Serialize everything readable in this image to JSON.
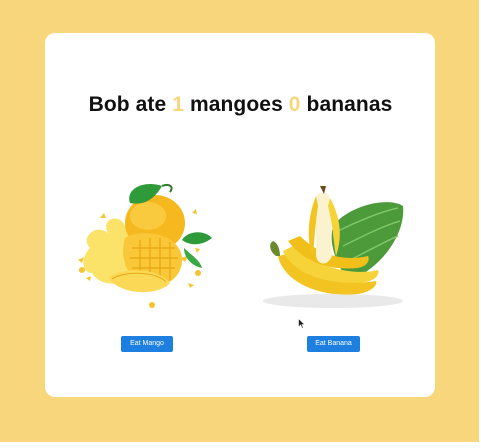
{
  "headline": {
    "prefix": "Bob ate",
    "mangoes_count": "1",
    "mangoes_label": "mangoes",
    "bananas_count": "0",
    "bananas_label": "bananas"
  },
  "buttons": {
    "eat_mango": "Eat Mango",
    "eat_banana": "Eat Banana"
  },
  "colors": {
    "background": "#f8d67c",
    "card": "#ffffff",
    "accent_count": "#f8d67c",
    "button": "#1d7fe0"
  },
  "icons": {
    "mango": "mango-illustration",
    "banana": "banana-illustration",
    "cursor": "mouse-pointer-icon"
  }
}
